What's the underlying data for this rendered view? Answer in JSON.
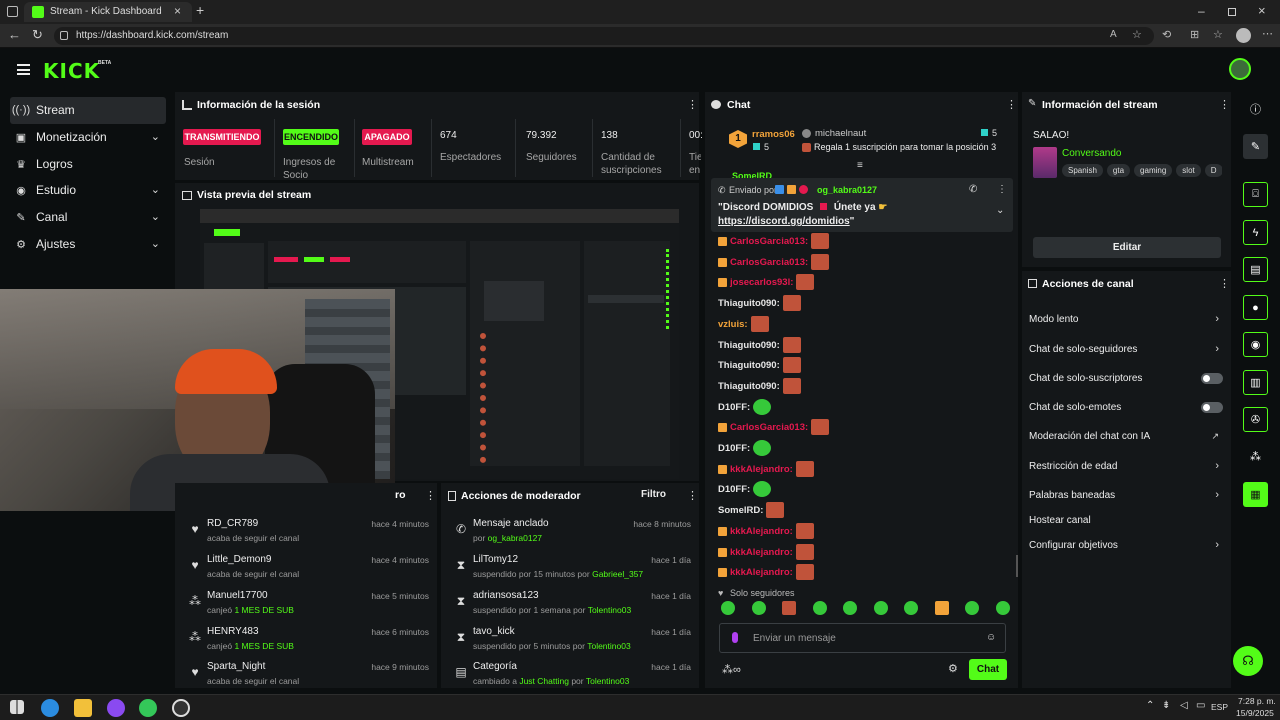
{
  "browser": {
    "tab_title": "Stream - Kick Dashboard",
    "url": "https://dashboard.kick.com/stream"
  },
  "header": {
    "logo": "KICK",
    "logo_badge": "BETA"
  },
  "sidebar": {
    "items": [
      {
        "label": "Stream",
        "icon": "stream-icon",
        "active": true
      },
      {
        "label": "Monetización",
        "icon": "monetization-icon",
        "expandable": true
      },
      {
        "label": "Logros",
        "icon": "trophy-icon"
      },
      {
        "label": "Estudio",
        "icon": "studio-icon",
        "expandable": true
      },
      {
        "label": "Canal",
        "icon": "channel-icon",
        "expandable": true
      },
      {
        "label": "Ajustes",
        "icon": "gear-icon",
        "expandable": true
      }
    ]
  },
  "session": {
    "title": "Información de la sesión",
    "badges": [
      {
        "text": "TRANSMITIENDO",
        "label": "Sesión",
        "color": "#e5194f"
      },
      {
        "text": "ENCENDIDO",
        "label": "Ingresos de Socio",
        "color": "#53fc18"
      },
      {
        "text": "APAGADO",
        "label": "Multistream",
        "color": "#e5194f"
      }
    ],
    "stats": [
      {
        "value": "674",
        "label": "Espectadores"
      },
      {
        "value": "79.392",
        "label": "Seguidores"
      },
      {
        "value": "138",
        "label": "Cantidad de suscripciones"
      },
      {
        "value": "00:",
        "label": "Tie en"
      }
    ]
  },
  "preview": {
    "title": "Vista previa del stream"
  },
  "feed": {
    "header_visible": "ro",
    "items": [
      {
        "name": "RD_CR789",
        "sub": "acaba de seguir el canal",
        "time": "hace 4 minutos",
        "icon": "heart-icon"
      },
      {
        "name": "Little_Demon9",
        "sub": "acaba de seguir el canal",
        "time": "hace 4 minutos",
        "icon": "heart-icon"
      },
      {
        "name": "Manuel17700",
        "sub_pre": "canjeó",
        "sub_hl": "1 MES DE SUB",
        "time": "hace 5 minutos",
        "icon": "gift-icon"
      },
      {
        "name": "HENRY483",
        "sub_pre": "canjeó",
        "sub_hl": "1 MES DE SUB",
        "time": "hace 6 minutos",
        "icon": "gift-icon"
      },
      {
        "name": "Sparta_Night",
        "sub": "acaba de seguir el canal",
        "time": "hace 9 minutos",
        "icon": "heart-icon"
      }
    ]
  },
  "mod_actions": {
    "title": "Acciones de moderador",
    "filter": "Filtro",
    "items": [
      {
        "name": "Mensaje anclado",
        "sub_pre": "por",
        "sub_hl": "og_kabra0127",
        "time": "hace 8 minutos",
        "icon": "pin-icon"
      },
      {
        "name": "LilTomy12",
        "sub_pre": "suspendido por 15 minutos por",
        "sub_hl": "Gabrieel_357",
        "time": "hace 1 día",
        "icon": "hourglass-icon"
      },
      {
        "name": "adriansosa123",
        "sub_pre": "suspendido por 1 semana por",
        "sub_hl": "Tolentino03",
        "time": "hace 1 día",
        "icon": "hourglass-icon"
      },
      {
        "name": "tavo_kick",
        "sub_pre": "suspendido por 5 minutos por",
        "sub_hl": "Tolentino03",
        "time": "hace 1 día",
        "icon": "hourglass-icon"
      },
      {
        "name": "Categoría",
        "sub_pre": "cambiado a",
        "sub_hl": "Just Chatting",
        "sub_mid": "por",
        "sub_hl2": "Tolentino03",
        "time": "hace 1 día",
        "icon": "category-icon"
      }
    ]
  },
  "chat": {
    "title": "Chat",
    "sub_banner": {
      "rank": "1",
      "user": "rramos06",
      "count": "5",
      "gifter": "michaelnaut",
      "gift_count": "5",
      "text": "Regala 1 suscripción para tomar la posición 3"
    },
    "partial_user": "SomelRD",
    "pinned": {
      "sent_by": "Enviado por",
      "user": "og_kabra0127",
      "line1": "\"Discord DOMIDIOS",
      "line1b": "Únete ya",
      "link": "https://discord.gg/domidios",
      "link_end": "\""
    },
    "messages": [
      {
        "user": "CarlosGarcia013:",
        "color": "#e5194f",
        "emotes": 1
      },
      {
        "user": "CarlosGarcia013:",
        "color": "#e5194f",
        "emotes": 1
      },
      {
        "user": "josecarlos93l:",
        "color": "#e5194f",
        "emotes": 1
      },
      {
        "user": "Thiaguito090:",
        "color": "#e6e6e6",
        "emotes": 1
      },
      {
        "user": "vzluis:",
        "color": "#f2a33a",
        "emotes": 1
      },
      {
        "user": "Thiaguito090:",
        "color": "#e6e6e6",
        "emotes": 1
      },
      {
        "user": "Thiaguito090:",
        "color": "#e6e6e6",
        "emotes": 1
      },
      {
        "user": "Thiaguito090:",
        "color": "#e6e6e6",
        "emotes": 1
      },
      {
        "user": "D10FF:",
        "color": "#e6e6e6",
        "emotes": 1
      },
      {
        "user": "CarlosGarcia013:",
        "color": "#e5194f",
        "emotes": 1
      },
      {
        "user": "D10FF:",
        "color": "#e6e6e6",
        "emotes": 1
      },
      {
        "user": "kkkAlejandro:",
        "color": "#e5194f",
        "emotes": 1
      },
      {
        "user": "D10FF:",
        "color": "#e6e6e6",
        "emotes": 1
      },
      {
        "user": "SomelRD:",
        "color": "#e6e6e6",
        "emotes": 1
      },
      {
        "user": "kkkAlejandro:",
        "color": "#e5194f",
        "emotes": 1
      },
      {
        "user": "kkkAlejandro:",
        "color": "#e5194f",
        "emotes": 1
      },
      {
        "user": "kkkAlejandro:",
        "color": "#e5194f",
        "emotes": 1
      }
    ],
    "followers_only": "Solo seguidores",
    "input_placeholder": "Enviar un mensaje",
    "send_label": "Chat"
  },
  "stream_info": {
    "title": "Información del stream",
    "stream_title": "SALAO!",
    "category": "Conversando",
    "tags": [
      "Spanish",
      "gta",
      "gaming",
      "slot",
      "D"
    ],
    "edit_label": "Editar"
  },
  "channel_actions": {
    "title": "Acciones de canal",
    "items": [
      {
        "label": "Modo lento",
        "control": "chevron"
      },
      {
        "label": "Chat de solo-seguidores",
        "control": "chevron"
      },
      {
        "label": "Chat de solo-suscriptores",
        "control": "toggle"
      },
      {
        "label": "Chat de solo-emotes",
        "control": "toggle"
      },
      {
        "label": "Moderación del chat con IA",
        "control": "external"
      },
      {
        "label": "Restricción de edad",
        "control": "chevron"
      },
      {
        "label": "Palabras baneadas",
        "control": "chevron"
      },
      {
        "label": "Hostear canal",
        "control": "none"
      },
      {
        "label": "Configurar objetivos",
        "control": "chevron"
      }
    ]
  },
  "taskbar": {
    "lang": "ESP",
    "time": "7:28 p. m.",
    "date": "15/9/2025"
  },
  "colors": {
    "brand": "#53fc18",
    "live": "#e5194f"
  }
}
